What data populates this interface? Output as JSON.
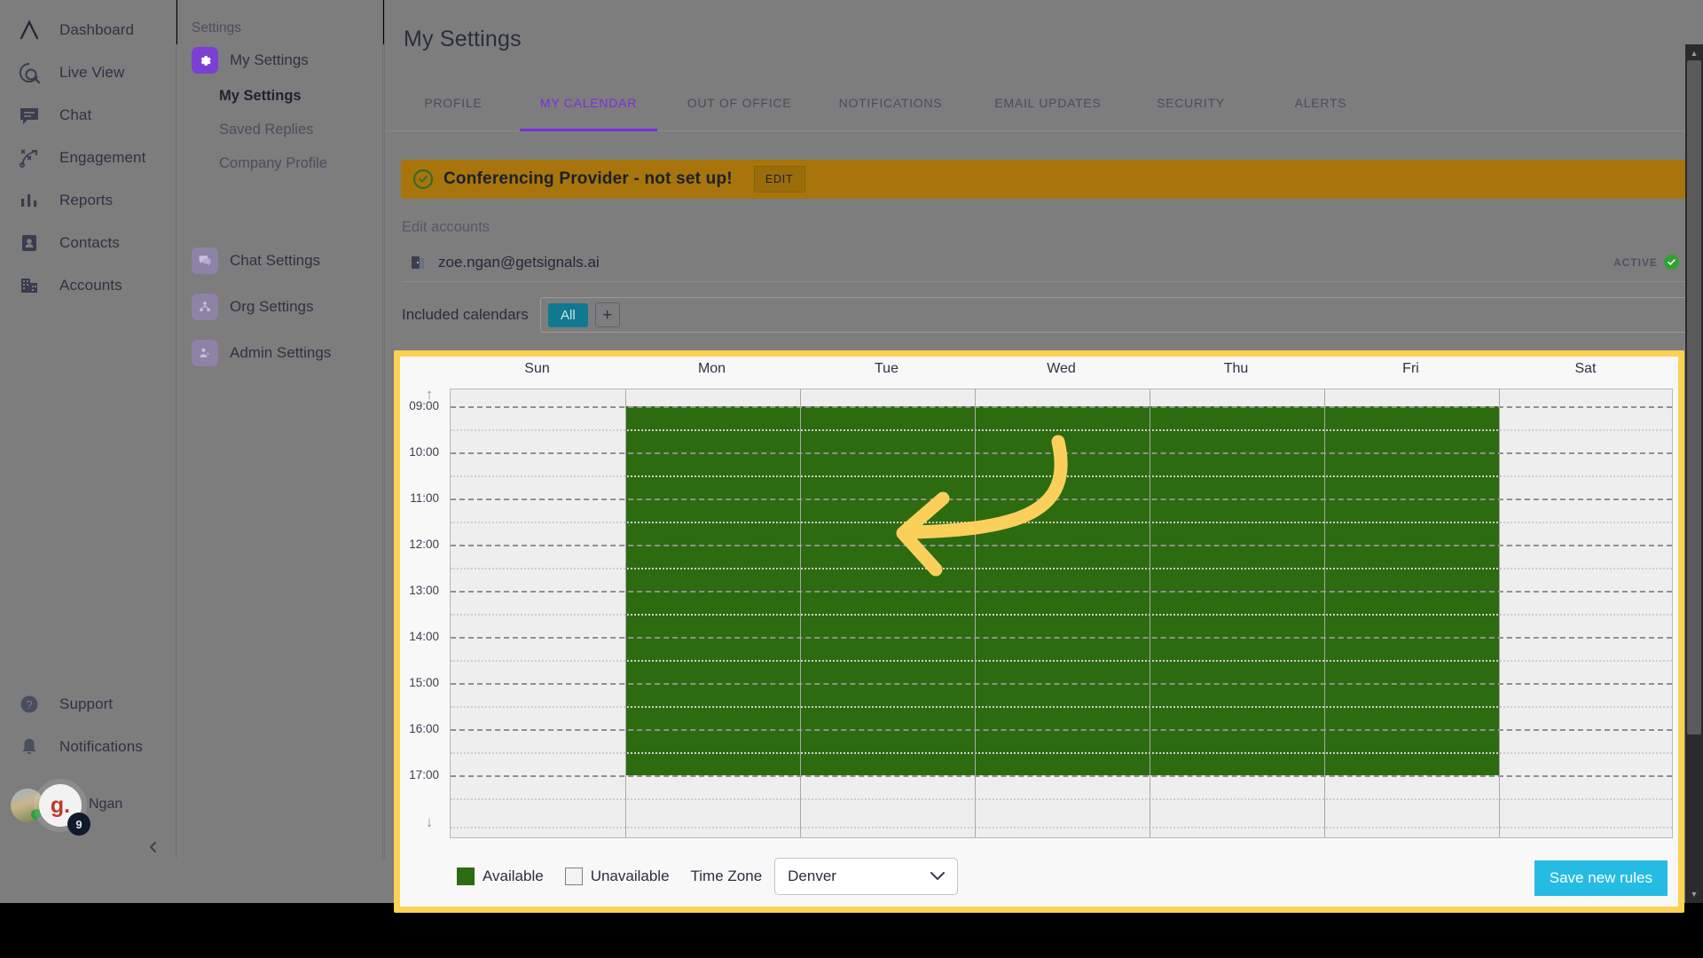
{
  "leftnav": {
    "items": [
      {
        "label": "Dashboard",
        "icon": "logo-icon"
      },
      {
        "label": "Live View",
        "icon": "live-view-icon"
      },
      {
        "label": "Chat",
        "icon": "chat-icon"
      },
      {
        "label": "Engagement",
        "icon": "engagement-icon"
      },
      {
        "label": "Reports",
        "icon": "reports-icon"
      },
      {
        "label": "Contacts",
        "icon": "contacts-icon"
      },
      {
        "label": "Accounts",
        "icon": "accounts-icon"
      }
    ],
    "bottom": [
      {
        "label": "Support",
        "icon": "help-icon"
      },
      {
        "label": "Notifications",
        "icon": "bell-icon"
      }
    ],
    "user": {
      "name": "Ngan",
      "badge_initial": "g.",
      "badge_count": "9"
    }
  },
  "subnav": {
    "title": "Settings",
    "groups": [
      {
        "label": "My Settings",
        "icon": "gear-icon",
        "active": true
      },
      {
        "label": "Chat Settings",
        "icon": "chat-icon",
        "active": false
      },
      {
        "label": "Org Settings",
        "icon": "org-icon",
        "active": false
      },
      {
        "label": "Admin Settings",
        "icon": "admin-icon",
        "active": false
      }
    ],
    "children": [
      {
        "label": "My Settings",
        "selected": true
      },
      {
        "label": "Saved Replies",
        "selected": false
      },
      {
        "label": "Company Profile",
        "selected": false
      }
    ]
  },
  "main": {
    "title": "My Settings",
    "tabs": [
      {
        "label": "PROFILE",
        "active": false
      },
      {
        "label": "MY CALENDAR",
        "active": true
      },
      {
        "label": "OUT OF OFFICE",
        "active": false
      },
      {
        "label": "NOTIFICATIONS",
        "active": false
      },
      {
        "label": "EMAIL UPDATES",
        "active": false
      },
      {
        "label": "SECURITY",
        "active": false
      },
      {
        "label": "ALERTS",
        "active": false
      }
    ],
    "banner": {
      "text": "Conferencing Provider - not set up!",
      "button": "EDIT",
      "color": "#a7750b",
      "icon": "check-circle-icon"
    },
    "accounts": {
      "section_label": "Edit accounts",
      "email": "zoe.ngan@getsignals.ai",
      "status": "ACTIVE"
    },
    "included_calendars": {
      "label": "Included calendars",
      "chip": "All",
      "add": "+"
    }
  },
  "calendar": {
    "days": [
      "Sun",
      "Mon",
      "Tue",
      "Wed",
      "Thu",
      "Fri",
      "Sat"
    ],
    "time_labels": [
      "09:00",
      "10:00",
      "11:00",
      "12:00",
      "13:00",
      "14:00",
      "15:00",
      "16:00",
      "17:00"
    ],
    "scroll_up": "↑",
    "scroll_down": "↓",
    "available_color": "#2d6b10",
    "highlight_color": "#fcd253",
    "availability": [
      {
        "day": "Sun",
        "start": "",
        "end": "",
        "available": false
      },
      {
        "day": "Mon",
        "start": "09:00",
        "end": "17:00",
        "available": true
      },
      {
        "day": "Tue",
        "start": "09:00",
        "end": "17:00",
        "available": true
      },
      {
        "day": "Wed",
        "start": "09:00",
        "end": "17:00",
        "available": true
      },
      {
        "day": "Thu",
        "start": "09:00",
        "end": "17:00",
        "available": true
      },
      {
        "day": "Fri",
        "start": "09:00",
        "end": "17:00",
        "available": true
      },
      {
        "day": "Sat",
        "start": "",
        "end": "",
        "available": false
      }
    ],
    "legend": {
      "available": "Available",
      "unavailable": "Unavailable"
    },
    "timezone": {
      "label": "Time Zone",
      "value": "Denver",
      "chevron": "⌄"
    },
    "save_button": "Save new rules"
  }
}
